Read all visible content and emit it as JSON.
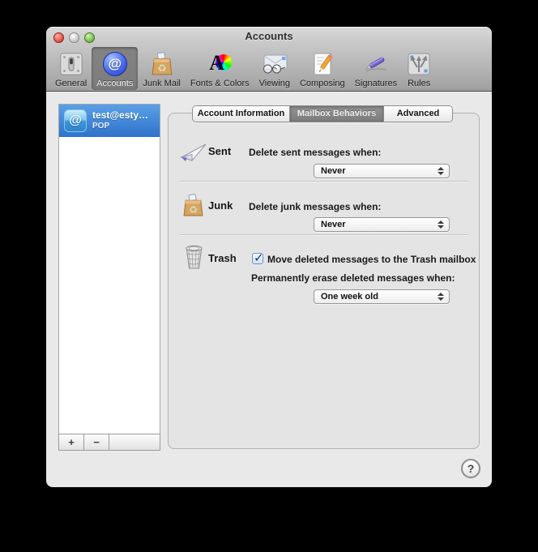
{
  "window": {
    "title": "Accounts",
    "traffic_lights": [
      "close",
      "minimize",
      "zoom"
    ]
  },
  "colors": {
    "selection_blue": "#2f72cb",
    "toolbar_gray": "#a9a9a9",
    "panel_bg": "#e4e4e4",
    "tab_selected": "#7c7c7c"
  },
  "toolbar": {
    "items": [
      {
        "label": "General",
        "icon": "general-icon",
        "selected": false
      },
      {
        "label": "Accounts",
        "icon": "accounts-icon",
        "selected": true
      },
      {
        "label": "Junk Mail",
        "icon": "junk-mail-icon",
        "selected": false
      },
      {
        "label": "Fonts & Colors",
        "icon": "fonts-colors-icon",
        "selected": false
      },
      {
        "label": "Viewing",
        "icon": "viewing-icon",
        "selected": false
      },
      {
        "label": "Composing",
        "icon": "composing-icon",
        "selected": false
      },
      {
        "label": "Signatures",
        "icon": "signatures-icon",
        "selected": false
      },
      {
        "label": "Rules",
        "icon": "rules-icon",
        "selected": false
      }
    ]
  },
  "sidebar": {
    "account": {
      "name": "test@esty…",
      "type": "POP",
      "selected": true,
      "icon": "pop-account-icon"
    },
    "add_label": "+",
    "remove_label": "−"
  },
  "tabs": [
    {
      "label": "Account Information",
      "selected": false
    },
    {
      "label": "Mailbox Behaviors",
      "selected": true
    },
    {
      "label": "Advanced",
      "selected": false
    }
  ],
  "panel": {
    "sent": {
      "label": "Sent",
      "icon": "sent-paper-airplane-icon",
      "prompt": "Delete sent messages when:",
      "value": "Never"
    },
    "junk": {
      "label": "Junk",
      "icon": "junk-bag-icon",
      "prompt": "Delete junk messages when:",
      "value": "Never"
    },
    "trash": {
      "label": "Trash",
      "icon": "trash-basket-icon",
      "checkbox_label": "Move deleted messages to the Trash mailbox",
      "checkbox_checked": true,
      "checkbox_mark": "✓",
      "prompt": "Permanently erase deleted messages when:",
      "value": "One week old"
    }
  },
  "help": {
    "label": "?"
  }
}
